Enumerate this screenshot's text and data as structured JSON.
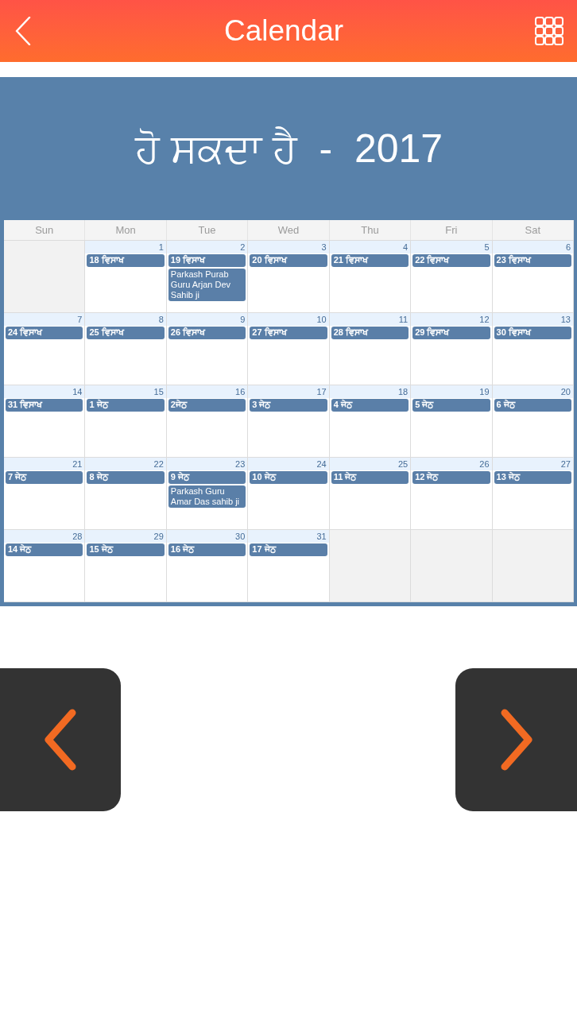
{
  "header": {
    "title": "Calendar"
  },
  "banner": {
    "title": "ਹੋ ਸਕਦਾ ਹੈ  -  2017"
  },
  "calendar": {
    "weekdays": [
      "Sun",
      "Mon",
      "Tue",
      "Wed",
      "Thu",
      "Fri",
      "Sat"
    ],
    "weeks": [
      [
        {
          "kind": "blank"
        },
        {
          "kind": "day",
          "day": "1",
          "label": "18 ਵਿਸਾਖ"
        },
        {
          "kind": "day",
          "day": "2",
          "label": "19 ਵਿਸਾਖ",
          "note": "Parkash Purab Guru Arjan Dev Sahib ji"
        },
        {
          "kind": "day",
          "day": "3",
          "label": "20 ਵਿਸਾਖ"
        },
        {
          "kind": "day",
          "day": "4",
          "label": "21 ਵਿਸਾਖ"
        },
        {
          "kind": "day",
          "day": "5",
          "label": "22 ਵਿਸਾਖ"
        },
        {
          "kind": "day",
          "day": "6",
          "label": "23 ਵਿਸਾਖ"
        }
      ],
      [
        {
          "kind": "day",
          "day": "7",
          "label": "24 ਵਿਸਾਖ"
        },
        {
          "kind": "day",
          "day": "8",
          "label": "25 ਵਿਸਾਖ"
        },
        {
          "kind": "day",
          "day": "9",
          "label": "26 ਵਿਸਾਖ"
        },
        {
          "kind": "day",
          "day": "10",
          "label": "27 ਵਿਸਾਖ"
        },
        {
          "kind": "day",
          "day": "11",
          "label": "28 ਵਿਸਾਖ"
        },
        {
          "kind": "day",
          "day": "12",
          "label": "29 ਵਿਸਾਖ"
        },
        {
          "kind": "day",
          "day": "13",
          "label": "30 ਵਿਸਾਖ"
        }
      ],
      [
        {
          "kind": "day",
          "day": "14",
          "label": "31 ਵਿਸਾਖ"
        },
        {
          "kind": "day",
          "day": "15",
          "label": "1 ਜੇਠ"
        },
        {
          "kind": "day",
          "day": "16",
          "label": "2ਜੇਠ"
        },
        {
          "kind": "day",
          "day": "17",
          "label": "3 ਜੇਠ"
        },
        {
          "kind": "day",
          "day": "18",
          "label": "4 ਜੇਠ"
        },
        {
          "kind": "day",
          "day": "19",
          "label": "5 ਜੇਠ"
        },
        {
          "kind": "day",
          "day": "20",
          "label": "6 ਜੇਠ"
        }
      ],
      [
        {
          "kind": "day",
          "day": "21",
          "label": "7 ਜੇਠ"
        },
        {
          "kind": "day",
          "day": "22",
          "label": "8 ਜੇਠ"
        },
        {
          "kind": "day",
          "day": "23",
          "label": "9 ਜੇਠ",
          "note": "Parkash Guru Amar Das sahib ji"
        },
        {
          "kind": "day",
          "day": "24",
          "label": "10 ਜੇਠ"
        },
        {
          "kind": "day",
          "day": "25",
          "label": "11 ਜੇਠ"
        },
        {
          "kind": "day",
          "day": "26",
          "label": "12 ਜੇਠ"
        },
        {
          "kind": "day",
          "day": "27",
          "label": "13 ਜੇਠ"
        }
      ],
      [
        {
          "kind": "day",
          "day": "28",
          "label": "14 ਜੇਠ"
        },
        {
          "kind": "day",
          "day": "29",
          "label": "15 ਜੇਠ"
        },
        {
          "kind": "day",
          "day": "30",
          "label": "16 ਜੇਠ"
        },
        {
          "kind": "day",
          "day": "31",
          "label": "17 ਜੇਠ"
        },
        {
          "kind": "blank"
        },
        {
          "kind": "blank"
        },
        {
          "kind": "blank"
        }
      ]
    ]
  }
}
